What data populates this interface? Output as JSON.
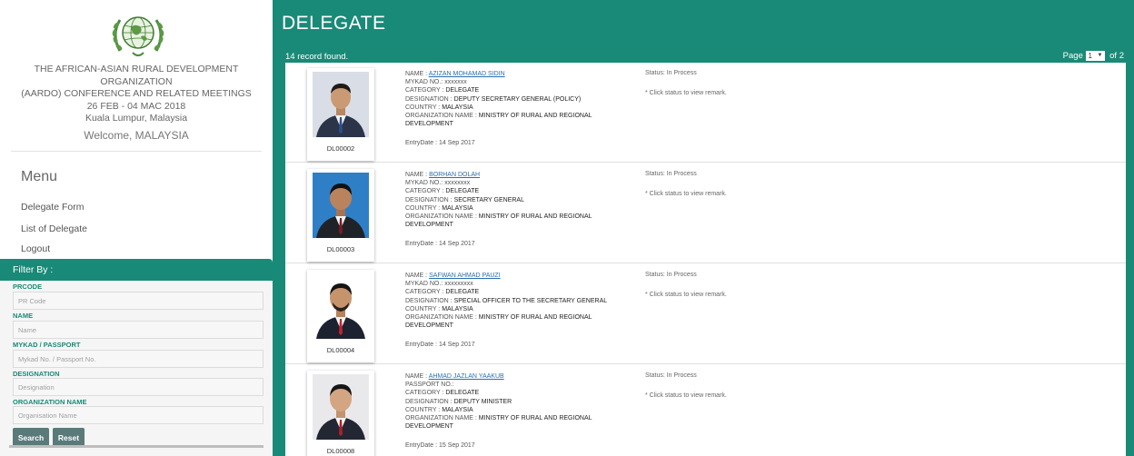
{
  "sidebar": {
    "org_lines": [
      "THE AFRICAN-ASIAN RURAL DEVELOPMENT ORGANIZATION",
      "(AARDO) CONFERENCE AND RELATED MEETINGS",
      "26 FEB - 04 MAC 2018",
      "Kuala Lumpur, Malaysia"
    ],
    "welcome": "Welcome, MALAYSIA",
    "menu_title": "Menu",
    "menu_items": [
      "Delegate Form",
      "List of Delegate",
      "Logout"
    ],
    "filter": {
      "title": "Filter By :",
      "fields": [
        {
          "label": "PRCODE",
          "placeholder": "PR Code"
        },
        {
          "label": "NAME",
          "placeholder": "Name"
        },
        {
          "label": "MYKAD / PASSPORT",
          "placeholder": "Mykad No. / Passport No."
        },
        {
          "label": "DESIGNATION",
          "placeholder": "Designation"
        },
        {
          "label": "ORGANIZATION NAME",
          "placeholder": "Organisation Name"
        }
      ],
      "search_label": "Search",
      "reset_label": "Reset"
    }
  },
  "main": {
    "title": "DELEGATE",
    "record_count": "14 record found.",
    "page_label": "Page",
    "page_current": "1",
    "page_of": "of 2",
    "field_labels": {
      "name": "NAME :",
      "mykad": "MYKAD NO.:",
      "passport": "PASSPORT NO.:",
      "category": "CATEGORY :",
      "designation": "DESIGNATION :",
      "country": "COUNTRY :",
      "organization": "ORGANIZATION NAME :",
      "entry": "EntryDate :"
    },
    "delegates": [
      {
        "code": "DL00002",
        "name": "AZIZAN MOHAMAD SIDIN",
        "id_label": "MYKAD NO.:",
        "id_value": "xxxxxxx",
        "category": "DELEGATE",
        "designation": "DEPUTY SECRETARY GENERAL (POLICY)",
        "country": "MALAYSIA",
        "organization": "MINISTRY OF RURAL AND REGIONAL DEVELOPMENT",
        "entry_date": "14 Sep 2017",
        "status": "Status: In Process",
        "remark": "* Click status to view remark."
      },
      {
        "code": "DL00003",
        "name": "BORHAN DOLAH",
        "id_label": "MYKAD NO.:",
        "id_value": "xxxxxxxx",
        "category": "DELEGATE",
        "designation": "SECRETARY GENERAL",
        "country": "MALAYSIA",
        "organization": "MINISTRY OF RURAL AND REGIONAL DEVELOPMENT",
        "entry_date": "14 Sep 2017",
        "status": "Status: In Process",
        "remark": "* Click status to view remark."
      },
      {
        "code": "DL00004",
        "name": "SAFWAN AHMAD PAUZI",
        "id_label": "MYKAD NO.:",
        "id_value": "xxxxxxxxx",
        "category": "DELEGATE",
        "designation": "SPECIAL OFFICER TO THE SECRETARY GENERAL",
        "country": "MALAYSIA",
        "organization": "MINISTRY OF RURAL AND REGIONAL DEVELOPMENT",
        "entry_date": "14 Sep 2017",
        "status": "Status: In Process",
        "remark": "* Click status to view remark."
      },
      {
        "code": "DL00008",
        "name": "AHMAD JAZLAN YAAKUB",
        "id_label": "PASSPORT NO.:",
        "id_value": "",
        "category": "DELEGATE",
        "designation": "DEPUTY MINISTER",
        "country": "MALAYSIA",
        "organization": "MINISTRY OF RURAL AND REGIONAL DEVELOPMENT",
        "entry_date": "15 Sep 2017",
        "status": "Status: In Process",
        "remark": "* Click status to view remark."
      }
    ]
  },
  "colors": {
    "accent": "#1a8a78",
    "link": "#2a6fb0",
    "button": "#5a7a7a"
  },
  "icons": {
    "logo": "aardo-globe-logo",
    "photo": "delegate-portrait"
  }
}
